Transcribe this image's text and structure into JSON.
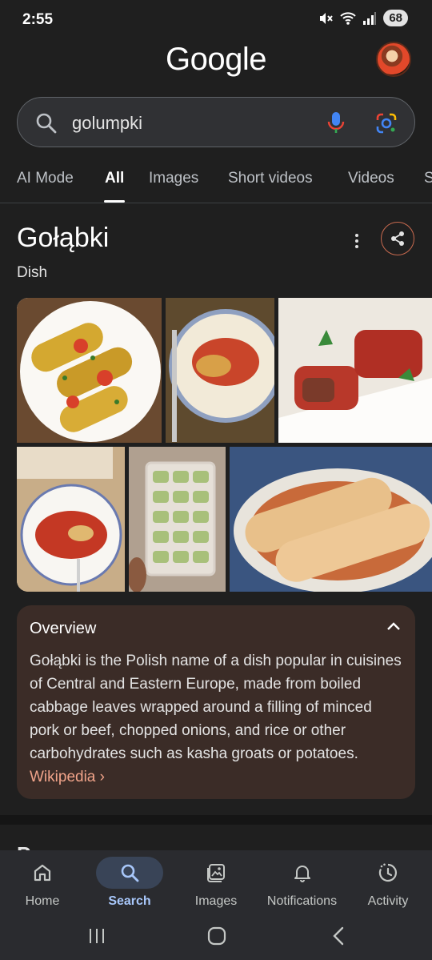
{
  "status": {
    "time": "2:55",
    "battery": "68"
  },
  "header": {
    "logo": "Google"
  },
  "search": {
    "query": "golumpki"
  },
  "tabs": [
    "AI Mode",
    "All",
    "Images",
    "Short videos",
    "Videos",
    "S"
  ],
  "knowledge_panel": {
    "title": "Gołąbki",
    "subtitle": "Dish"
  },
  "overview": {
    "title": "Overview",
    "text": "Gołąbki is the Polish name of a dish popular in cuisines of Central and Eastern Europe, made from boiled cabbage leaves wrapped around a filling of minced pork or beef, chopped onions, and rice or other carbohydrates such as kasha groats or potatoes.",
    "link": "Wikipedia ›"
  },
  "peek": "Peo",
  "bottom_nav": [
    {
      "label": "Home",
      "icon": "home-icon"
    },
    {
      "label": "Search",
      "icon": "search-icon"
    },
    {
      "label": "Images",
      "icon": "images-icon"
    },
    {
      "label": "Notifications",
      "icon": "bell-icon"
    },
    {
      "label": "Activity",
      "icon": "activity-icon"
    }
  ],
  "colors": {
    "accent": "#a8c7fa",
    "overview_bg": "#3b2c27",
    "link": "#f0a389"
  }
}
